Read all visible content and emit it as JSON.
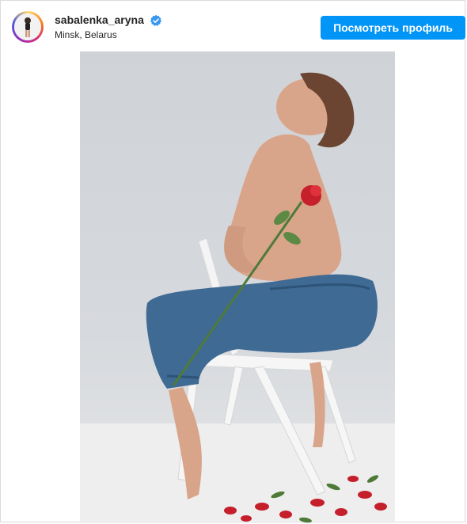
{
  "post": {
    "username": "sabalenka_aryna",
    "verified": true,
    "location": "Minsk, Belarus",
    "view_profile_label": "Посмотреть профиль"
  },
  "icons": {
    "verified": "verified-badge-icon"
  },
  "colors": {
    "button_bg": "#0095f6",
    "button_text": "#ffffff",
    "verified_blue": "#3897f0",
    "text": "#262626"
  },
  "photo": {
    "subject": "woman in jeans seated on white folding chair holding a red rose, rose petals on floor"
  }
}
